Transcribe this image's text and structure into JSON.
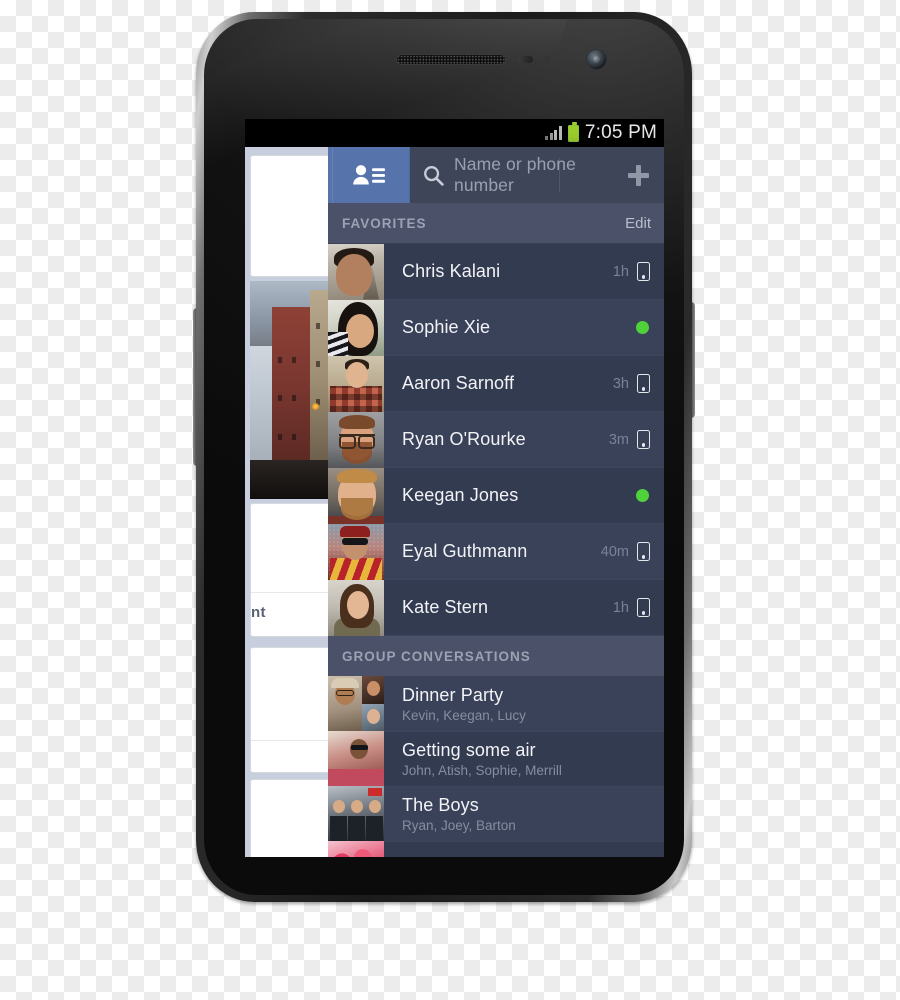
{
  "status_bar": {
    "clock": "7:05 PM",
    "signal_icon": "signal-bars-icon",
    "battery_icon": "battery-full-icon"
  },
  "topbar": {
    "contacts_icon": "contacts-person-list-icon",
    "search_icon": "search-magnifier-icon",
    "search_placeholder": "Name or phone number",
    "search_value": "",
    "add_icon": "plus-icon"
  },
  "sections": [
    {
      "title": "FAVORITES",
      "action_label": "Edit",
      "rows": [
        {
          "name": "Chris Kalani",
          "time": "1h",
          "status_icon": "mobile-phone-icon",
          "avatar": "av-chris"
        },
        {
          "name": "Sophie Xie",
          "time": "",
          "status_icon": "online-dot-icon",
          "avatar": "av-sophie"
        },
        {
          "name": "Aaron Sarnoff",
          "time": "3h",
          "status_icon": "mobile-phone-icon",
          "avatar": "av-aaron"
        },
        {
          "name": "Ryan O'Rourke",
          "time": "3m",
          "status_icon": "mobile-phone-icon",
          "avatar": "av-ryan"
        },
        {
          "name": "Keegan Jones",
          "time": "",
          "status_icon": "online-dot-icon",
          "avatar": "av-keegan"
        },
        {
          "name": "Eyal Guthmann",
          "time": "40m",
          "status_icon": "mobile-phone-icon",
          "avatar": "av-eyal"
        },
        {
          "name": "Kate Stern",
          "time": "1h",
          "status_icon": "mobile-phone-icon",
          "avatar": "av-kate"
        }
      ]
    },
    {
      "title": "GROUP CONVERSATIONS",
      "action_label": "",
      "rows": [
        {
          "name": "Dinner Party",
          "members": "Kevin, Keegan, Lucy"
        },
        {
          "name": "Getting some air",
          "members": "John, Atish, Sophie, Merrill"
        },
        {
          "name": "The Boys",
          "members": "Ryan, Joey, Barton"
        }
      ]
    }
  ],
  "feed_peek": {
    "text_fragment": "nt",
    "menu_icon": "three-dot-overflow-icon"
  },
  "colors": {
    "facebook_blue": "#5673ac",
    "drawer_bg": "#3a4259",
    "row_bg": "#333b51",
    "section_header_bg": "#4a5169",
    "online_green": "#4ed13a",
    "battery_green": "#9ccc2b",
    "name_text": "#f2f3f6",
    "muted_text": "#868da0"
  }
}
